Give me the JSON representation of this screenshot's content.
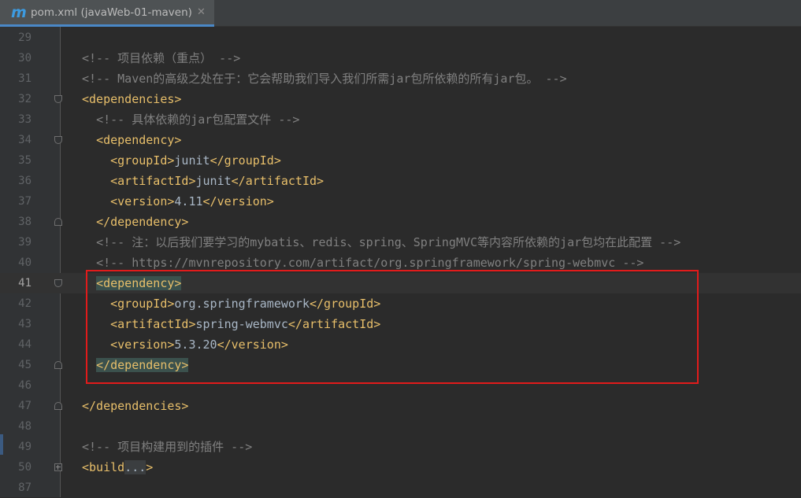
{
  "tab": {
    "icon": "m",
    "icon_name": "maven-icon",
    "title": "pom.xml (javaWeb-01-maven)",
    "close": "✕"
  },
  "colors": {
    "background": "#2b2b2b",
    "tag": "#e8bf6a",
    "text": "#a9b7c6",
    "comment": "#808080",
    "line_number": "#606366",
    "annotation_box": "#e21b1b"
  },
  "active_line": "41",
  "lines": [
    {
      "num": "29",
      "indent": "",
      "parts": []
    },
    {
      "num": "30",
      "indent": "",
      "parts": [
        {
          "t": "cmt",
          "v": "<!-- 项目依赖（重点） -->"
        }
      ]
    },
    {
      "num": "31",
      "indent": "",
      "parts": [
        {
          "t": "cmt",
          "v": "<!-- Maven的高级之处在于：它会帮助我们导入我们所需jar包所依赖的所有jar包。 -->"
        }
      ]
    },
    {
      "num": "32",
      "indent": "",
      "fold": "open",
      "parts": [
        {
          "t": "tag",
          "v": "<dependencies>"
        }
      ]
    },
    {
      "num": "33",
      "indent": "  ",
      "parts": [
        {
          "t": "cmt",
          "v": "<!-- 具体依赖的jar包配置文件 -->"
        }
      ]
    },
    {
      "num": "34",
      "indent": "  ",
      "fold": "open",
      "parts": [
        {
          "t": "tag",
          "v": "<dependency>"
        }
      ]
    },
    {
      "num": "35",
      "indent": "    ",
      "parts": [
        {
          "t": "tag",
          "v": "<groupId>"
        },
        {
          "t": "txt",
          "v": "junit"
        },
        {
          "t": "tag",
          "v": "</groupId>"
        }
      ]
    },
    {
      "num": "36",
      "indent": "    ",
      "parts": [
        {
          "t": "tag",
          "v": "<artifactId>"
        },
        {
          "t": "txt",
          "v": "junit"
        },
        {
          "t": "tag",
          "v": "</artifactId>"
        }
      ]
    },
    {
      "num": "37",
      "indent": "    ",
      "parts": [
        {
          "t": "tag",
          "v": "<version>"
        },
        {
          "t": "txt",
          "v": "4.11"
        },
        {
          "t": "tag",
          "v": "</version>"
        }
      ]
    },
    {
      "num": "38",
      "indent": "  ",
      "fold": "close",
      "parts": [
        {
          "t": "tag",
          "v": "</dependency>"
        }
      ]
    },
    {
      "num": "39",
      "indent": "  ",
      "parts": [
        {
          "t": "cmt",
          "v": "<!-- 注：以后我们要学习的mybatis、redis、spring、SpringMVC等内容所依赖的jar包均在此配置 -->"
        }
      ]
    },
    {
      "num": "40",
      "indent": "  ",
      "parts": [
        {
          "t": "cmt",
          "v": "<!-- https://mvnrepository.com/artifact/org.springframework/spring-webmvc -->"
        }
      ]
    },
    {
      "num": "41",
      "indent": "  ",
      "fold": "open",
      "parts": [
        {
          "t": "tag hl-tag",
          "v": "<dependency>"
        }
      ]
    },
    {
      "num": "42",
      "indent": "    ",
      "parts": [
        {
          "t": "tag",
          "v": "<groupId>"
        },
        {
          "t": "txt",
          "v": "org.springframework"
        },
        {
          "t": "tag",
          "v": "</groupId>"
        }
      ]
    },
    {
      "num": "43",
      "indent": "    ",
      "parts": [
        {
          "t": "tag",
          "v": "<artifactId>"
        },
        {
          "t": "txt",
          "v": "spring-webmvc"
        },
        {
          "t": "tag",
          "v": "</artifactId>"
        }
      ]
    },
    {
      "num": "44",
      "indent": "    ",
      "parts": [
        {
          "t": "tag",
          "v": "<version>"
        },
        {
          "t": "txt",
          "v": "5.3.20"
        },
        {
          "t": "tag",
          "v": "</version>"
        }
      ]
    },
    {
      "num": "45",
      "indent": "  ",
      "fold": "close",
      "parts": [
        {
          "t": "tag hl-tag",
          "v": "</dependency>"
        }
      ]
    },
    {
      "num": "46",
      "indent": "",
      "parts": []
    },
    {
      "num": "47",
      "indent": "",
      "fold": "close",
      "parts": [
        {
          "t": "tag",
          "v": "</dependencies>"
        }
      ]
    },
    {
      "num": "48",
      "indent": "",
      "parts": []
    },
    {
      "num": "49",
      "indent": "",
      "parts": [
        {
          "t": "cmt",
          "v": "<!-- 项目构建用到的插件 -->"
        }
      ]
    },
    {
      "num": "50",
      "indent": "",
      "fold": "plus",
      "parts": [
        {
          "t": "tag",
          "v": "<build"
        },
        {
          "t": "fold-dots",
          "v": "..."
        },
        {
          "t": "tag",
          "v": ">"
        }
      ]
    },
    {
      "num": "87",
      "indent": "",
      "parts": []
    }
  ]
}
